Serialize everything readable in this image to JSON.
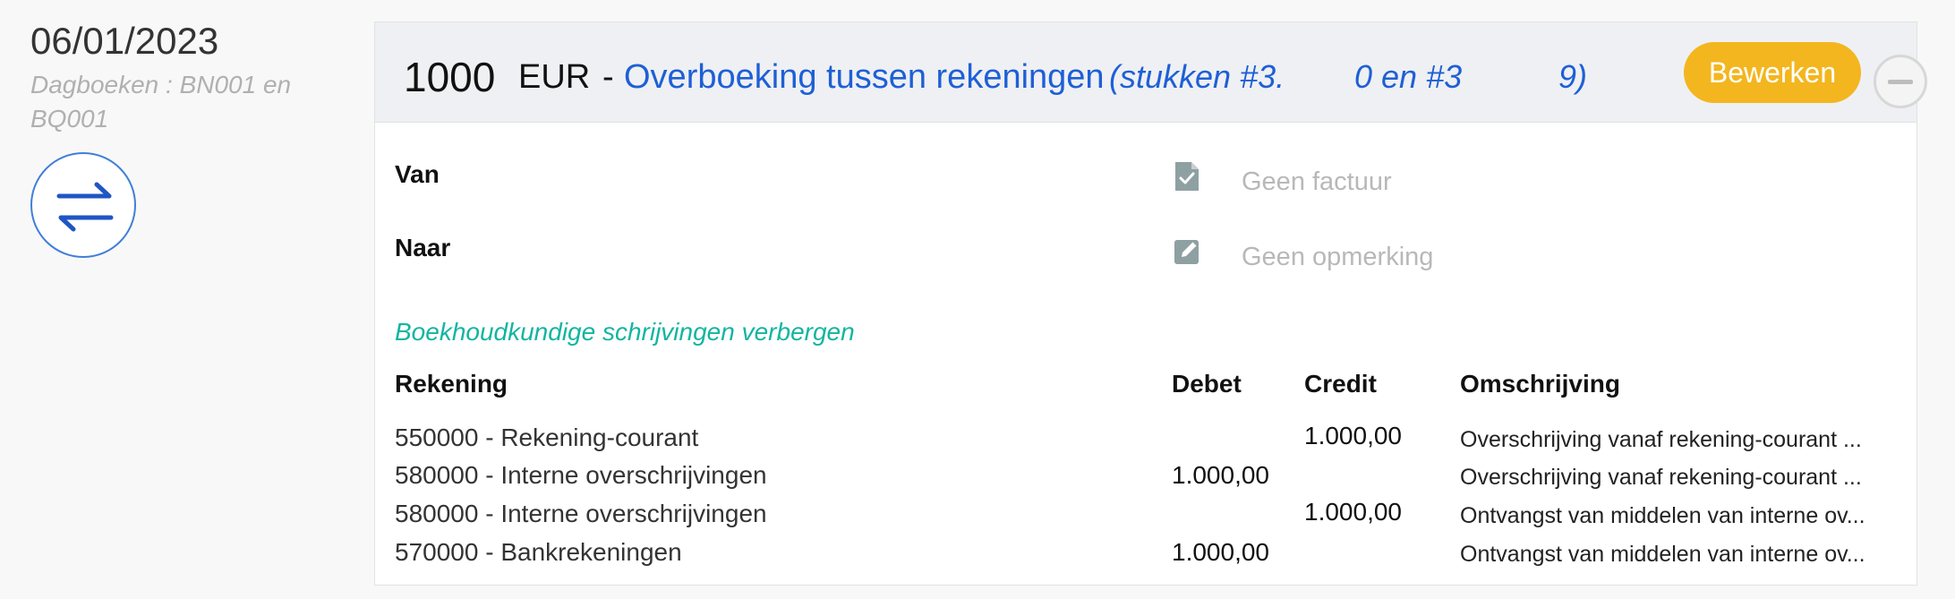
{
  "entry": {
    "date": "06/01/2023",
    "journals": "Dagboeken : BN001 en BQ001"
  },
  "header": {
    "amount": "1000",
    "currency": "EUR",
    "separator": "-",
    "title": "Overboeking tussen rekeningen",
    "pieces_part1": "(stukken #3.",
    "pieces_part2": "0 en #3",
    "pieces_part3": "9)",
    "edit_label": "Bewerken"
  },
  "details": {
    "from_label": "Van",
    "to_label": "Naar",
    "invoice_text": "Geen factuur",
    "remark_text": "Geen opmerking",
    "toggle_link": "Boekhoudkundige schrijvingen verbergen"
  },
  "table": {
    "headers": {
      "account": "Rekening",
      "debit": "Debet",
      "credit": "Credit",
      "description": "Omschrijving"
    },
    "rows": [
      {
        "account": "550000 - Rekening-courant",
        "debit": "",
        "credit": "1.000,00",
        "description": "Overschrijving vanaf rekening-courant ..."
      },
      {
        "account": "580000 - Interne overschrijvingen",
        "debit": "1.000,00",
        "credit": "",
        "description": "Overschrijving vanaf rekening-courant ..."
      },
      {
        "account": "580000 - Interne overschrijvingen",
        "debit": "",
        "credit": "1.000,00",
        "description": "Ontvangst van middelen van interne ov..."
      },
      {
        "account": "570000 - Bankrekeningen",
        "debit": "1.000,00",
        "credit": "",
        "description": "Ontvangst van middelen van interne ov..."
      }
    ]
  },
  "icons": {
    "transfer": "transfer-arrows-icon",
    "invoice": "document-check-icon",
    "remark": "edit-note-icon"
  },
  "colors": {
    "link_blue": "#1e5fd6",
    "edit_button": "#f3b61f",
    "toggle_link": "#12b5a0"
  }
}
